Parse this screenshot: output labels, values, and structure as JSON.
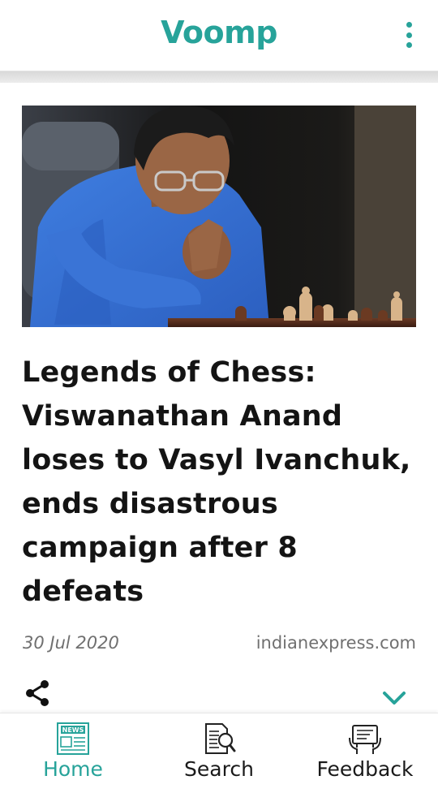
{
  "app": {
    "brand": "Voomp",
    "accent_color": "#27a39a",
    "menu_icon": "more-vert-icon"
  },
  "article": {
    "image_alt": "Viswanathan Anand at a chessboard",
    "headline": "Legends of Chess: Viswanathan Anand loses to Vasyl Ivanchuk, ends disastrous campaign after 8 defeats",
    "date": "30 Jul 2020",
    "source": "indianexpress.com",
    "share_icon": "share-icon",
    "expand_icon": "chevron-down-icon"
  },
  "nav": {
    "items": [
      {
        "label": "Home",
        "icon": "newspaper-icon",
        "active": true,
        "icon_text": "NEWS"
      },
      {
        "label": "Search",
        "icon": "search-document-icon",
        "active": false
      },
      {
        "label": "Feedback",
        "icon": "feedback-board-icon",
        "active": false
      }
    ]
  }
}
